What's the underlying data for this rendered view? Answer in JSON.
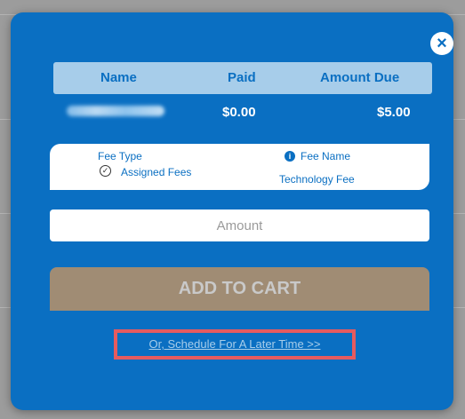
{
  "table": {
    "headers": [
      "Name",
      "Paid",
      "Amount Due"
    ],
    "row": {
      "paid": "$0.00",
      "amount_due": "$5.00"
    }
  },
  "fee": {
    "type_label": "Fee Type",
    "type_value": "Assigned Fees",
    "name_label": "Fee Name",
    "name_value": "Technology Fee"
  },
  "amount_input": {
    "placeholder": "Amount",
    "value": ""
  },
  "add_to_cart_label": "ADD TO CART",
  "schedule_link_label": "Or, Schedule For A Later Time >>",
  "colors": {
    "modal": "#0a6fc2",
    "header": "#a7cdea",
    "add_button": "#a08c74",
    "highlight": "#e65b5f"
  },
  "icons": {
    "close": "close-icon",
    "check": "check-circle-icon",
    "info": "info-icon"
  }
}
